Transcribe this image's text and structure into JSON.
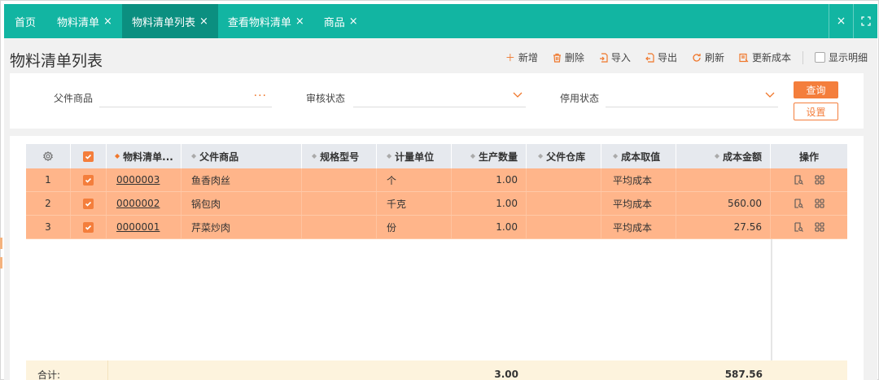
{
  "tabs": [
    {
      "label": "首页",
      "closable": false,
      "active": false
    },
    {
      "label": "物料清单",
      "closable": true,
      "active": false
    },
    {
      "label": "物料清单列表",
      "closable": true,
      "active": true
    },
    {
      "label": "查看物料清单",
      "closable": true,
      "active": false
    },
    {
      "label": "商品",
      "closable": true,
      "active": false
    }
  ],
  "close_glyph": "×",
  "page_title": "物料清单列表",
  "toolbar": {
    "add": "新增",
    "delete": "删除",
    "import": "导入",
    "export": "导出",
    "refresh": "刷新",
    "update_cost": "更新成本",
    "show_detail": "显示明细"
  },
  "filters": {
    "parent_goods_label": "父件商品",
    "parent_goods_more": "···",
    "review_status_label": "审核状态",
    "disabled_status_label": "停用状态",
    "query_button": "查询",
    "settings_button": "设置"
  },
  "table": {
    "headers": {
      "bom_no": "物料清单...",
      "parent_goods": "父件商品",
      "spec": "规格型号",
      "unit": "计量单位",
      "quantity": "生产数量",
      "parent_wh": "父件仓库",
      "cost_method": "成本取值",
      "cost_amount": "成本金额",
      "actions": "操作"
    },
    "rows": [
      {
        "index": "1",
        "bom_no": "0000003",
        "parent_goods": "鱼香肉丝",
        "spec": "",
        "unit": "个",
        "quantity": "1.00",
        "parent_wh": "",
        "cost_method": "平均成本",
        "cost_amount": ""
      },
      {
        "index": "2",
        "bom_no": "0000002",
        "parent_goods": "锅包肉",
        "spec": "",
        "unit": "千克",
        "quantity": "1.00",
        "parent_wh": "",
        "cost_method": "平均成本",
        "cost_amount": "560.00"
      },
      {
        "index": "3",
        "bom_no": "0000001",
        "parent_goods": "芹菜炒肉",
        "spec": "",
        "unit": "份",
        "quantity": "1.00",
        "parent_wh": "",
        "cost_method": "平均成本",
        "cost_amount": "27.56"
      }
    ],
    "summary": {
      "label": "合计:",
      "quantity": "3.00",
      "cost_amount": "587.56"
    }
  },
  "colors": {
    "teal": "#12b5a2",
    "teal_active": "#0b8f80",
    "orange": "#f47e3c",
    "row_selected": "#ffb58a",
    "summary_bg": "#fdf3dd"
  },
  "icons": {
    "close": "close-icon",
    "fullscreen": "fullscreen-icon",
    "add": "plus-icon",
    "delete": "trash-icon",
    "import": "import-icon",
    "export": "export-icon",
    "refresh": "refresh-icon",
    "update_cost": "update-cost-icon",
    "column_settings": "gear-icon",
    "view": "view-doc-icon",
    "more": "grid-icon"
  }
}
